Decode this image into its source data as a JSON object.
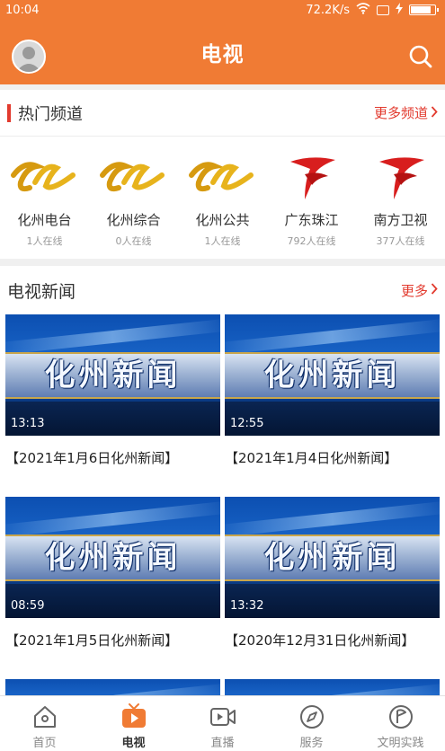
{
  "status": {
    "time": "10:04",
    "speed": "72.2K/s"
  },
  "header": {
    "title": "电视"
  },
  "hot_channels": {
    "title": "热门频道",
    "more": "更多频道",
    "items": [
      {
        "name": "化州电台",
        "count": "1人在线",
        "logo": "huazhou-logo"
      },
      {
        "name": "化州综合",
        "count": "0人在线",
        "logo": "huazhou-logo"
      },
      {
        "name": "化州公共",
        "count": "1人在线",
        "logo": "huazhou-logo"
      },
      {
        "name": "广东珠江",
        "count": "792人在线",
        "logo": "gdtv-logo"
      },
      {
        "name": "南方卫视",
        "count": "377人在线",
        "logo": "gdtv-logo"
      }
    ]
  },
  "tv_news": {
    "title": "电视新闻",
    "more": "更多",
    "items": [
      {
        "thumb_text": "化州新闻",
        "duration": "13:13",
        "caption": "【2021年1月6日化州新闻】"
      },
      {
        "thumb_text": "化州新闻",
        "duration": "12:55",
        "caption": "【2021年1月4日化州新闻】"
      },
      {
        "thumb_text": "化州新闻",
        "duration": "08:59",
        "caption": "【2021年1月5日化州新闻】"
      },
      {
        "thumb_text": "化州新闻",
        "duration": "13:32",
        "caption": "【2020年12月31日化州新闻】"
      }
    ]
  },
  "tabbar": {
    "items": [
      {
        "label": "首页",
        "icon": "home-icon"
      },
      {
        "label": "电视",
        "icon": "tv-icon"
      },
      {
        "label": "直播",
        "icon": "live-video-icon"
      },
      {
        "label": "服务",
        "icon": "compass-icon"
      },
      {
        "label": "文明实践",
        "icon": "flag-icon"
      }
    ],
    "active": "电视"
  },
  "colors": {
    "brand": "#f07b34",
    "accent": "#e23a2e"
  }
}
